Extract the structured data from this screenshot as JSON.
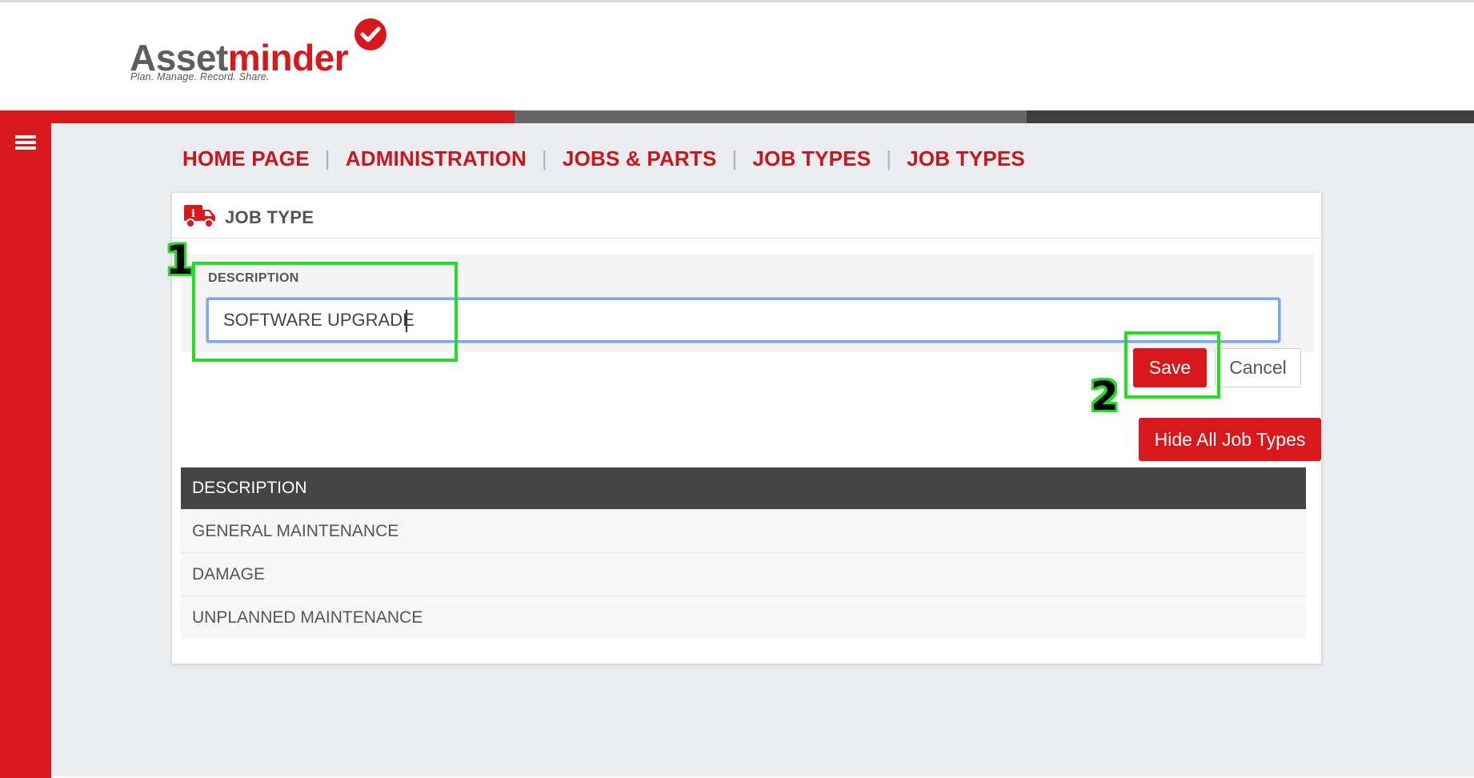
{
  "brand": {
    "name_part1": "Asset",
    "name_part2": "minder",
    "tagline": "Plan. Manage. Record. Share.",
    "colors": {
      "primary": "#d7191d",
      "dark": "#444444",
      "mid": "#666666",
      "background": "#eaecf0"
    }
  },
  "breadcrumb": [
    "HOME PAGE",
    "ADMINISTRATION",
    "JOBS & PARTS",
    "JOB TYPES",
    "JOB TYPES"
  ],
  "card": {
    "title": "JOB TYPE",
    "icon": "truck-icon"
  },
  "form": {
    "description_label": "DESCRIPTION",
    "description_value": "SOFTWARE UPGRADE",
    "save_label": "Save",
    "cancel_label": "Cancel"
  },
  "list_toggle_label": "Hide All Job Types",
  "table": {
    "header": "DESCRIPTION",
    "rows": [
      "GENERAL MAINTENANCE",
      "DAMAGE",
      "UNPLANNED MAINTENANCE"
    ]
  },
  "annotations": {
    "step1": "1",
    "step2": "2",
    "highlight_color": "#22dd22"
  }
}
